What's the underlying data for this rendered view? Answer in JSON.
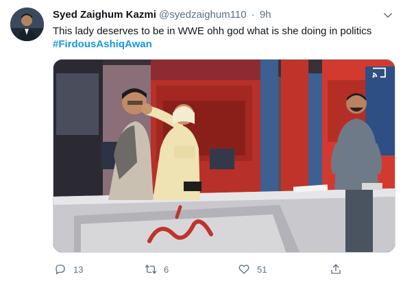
{
  "tweet": {
    "author_name": "Syed Zaighum Kazmi",
    "author_handle": "@syedzaighum110",
    "separator": "·",
    "time": "9h",
    "text": "This lady deserves to be in WWE ohh god what is she doing in politics",
    "hashtag": "#FirdousAshiqAwan"
  },
  "actions": {
    "reply_count": "13",
    "retweet_count": "6",
    "like_count": "51"
  },
  "icons": {
    "reply": "reply-icon",
    "retweet": "retweet-icon",
    "like": "like-icon",
    "share": "share-icon",
    "more": "chevron-down-icon",
    "cast": "cast-icon"
  },
  "colors": {
    "hashtag": "#1b95e0",
    "muted": "#5b7083",
    "studio_red": "#c0332b",
    "studio_blue": "#3d5f92"
  }
}
